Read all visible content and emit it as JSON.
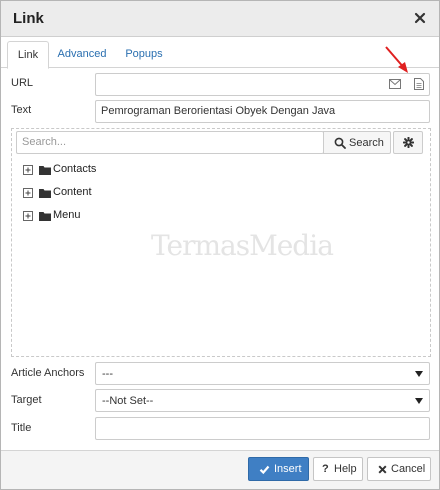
{
  "dialog": {
    "title": "Link"
  },
  "tabs": [
    "Link",
    "Advanced",
    "Popups"
  ],
  "url": {
    "label": "URL",
    "value": ""
  },
  "text": {
    "label": "Text",
    "value": "Pemrograman Berorientasi Obyek Dengan Java"
  },
  "browser": {
    "search_placeholder": "Search...",
    "search_label": "Search",
    "tree": [
      "Contacts",
      "Content",
      "Menu"
    ]
  },
  "article_anchors": {
    "label": "Article Anchors",
    "value": "---"
  },
  "target": {
    "label": "Target",
    "value": "--Not Set--"
  },
  "title_field": {
    "label": "Title",
    "value": ""
  },
  "buttons": {
    "insert": "Insert",
    "help": "Help",
    "cancel": "Cancel"
  },
  "watermark": "TermasMedia",
  "colors": {
    "primary": "#3f7fc4",
    "annotation_arrow": "#e02020",
    "tab_link": "#2a6fb0"
  },
  "icons": [
    "close-icon",
    "email-icon",
    "document-icon",
    "search-icon",
    "gear-icon",
    "expand-icon",
    "folder-icon",
    "caret-down-icon",
    "check-icon",
    "question-icon",
    "x-icon",
    "red-arrow"
  ]
}
